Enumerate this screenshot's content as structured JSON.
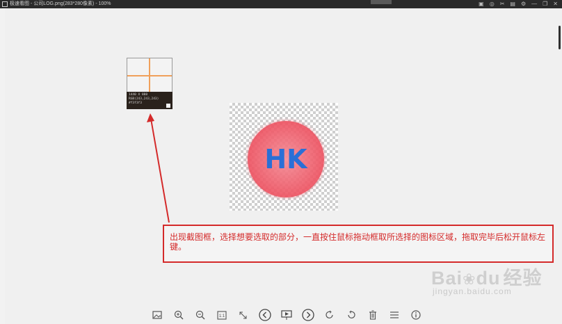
{
  "window": {
    "title": "极速看图 - 公司LOG.png(283*280像素) - 100%",
    "titlebar_icons": [
      "image-icon",
      "layers-icon",
      "crop-icon",
      "notes-icon",
      "settings-icon",
      "minimize-icon",
      "maximize-icon",
      "close-icon"
    ]
  },
  "magnifier": {
    "line1": "1440 X 888",
    "line2": "RGB(243,243,243)",
    "line3": "#f3f3f3",
    "crosshair_color": "#f0a05a",
    "swatch_color": "#f3f3f3"
  },
  "image": {
    "logo_text": "HK",
    "logo_text_color": "#2a6fd6",
    "circle_color": "#ee5060"
  },
  "annotation": {
    "text": "出现截图框，选择想要选取的部分，一直按住鼠标拖动框取所选择的图标区域，拖取完毕后松开鼠标左键。",
    "color": "#d42a2a"
  },
  "toolbar": {
    "items": [
      {
        "icon": "image-icon",
        "label": ""
      },
      {
        "icon": "zoom-in-icon",
        "label": ""
      },
      {
        "icon": "zoom-out-icon",
        "label": ""
      },
      {
        "icon": "actual-size-icon",
        "label": "1:1"
      },
      {
        "icon": "fit-screen-icon",
        "label": ""
      },
      {
        "icon": "previous-icon",
        "label": ""
      },
      {
        "icon": "slideshow-icon",
        "label": ""
      },
      {
        "icon": "next-icon",
        "label": ""
      },
      {
        "icon": "rotate-right-icon",
        "label": ""
      },
      {
        "icon": "rotate-left-icon",
        "label": ""
      },
      {
        "icon": "delete-icon",
        "label": ""
      },
      {
        "icon": "menu-icon",
        "label": ""
      },
      {
        "icon": "info-icon",
        "label": ""
      }
    ]
  },
  "watermark": {
    "brand": "Bai",
    "brand2": "du",
    "brand3": "经验",
    "url": "jingyan.baidu.com"
  }
}
